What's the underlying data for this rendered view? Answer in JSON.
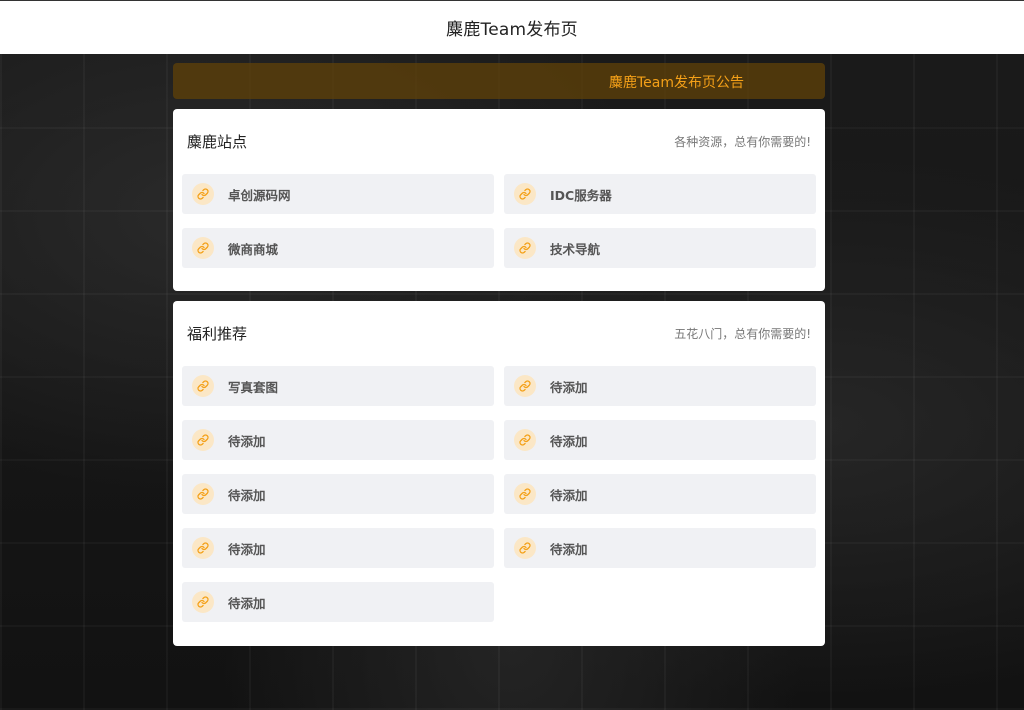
{
  "header": {
    "title": "麋鹿Team发布页"
  },
  "notice": {
    "text": "麋鹿Team发布页公告"
  },
  "sections": [
    {
      "title": "麋鹿站点",
      "subtitle": "各种资源，总有你需要的!",
      "links": [
        {
          "label": "卓创源码网",
          "icon": "link-icon"
        },
        {
          "label": "IDC服务器",
          "icon": "link-icon"
        },
        {
          "label": "微商商城",
          "icon": "link-icon"
        },
        {
          "label": "技术导航",
          "icon": "link-icon"
        }
      ]
    },
    {
      "title": "福利推荐",
      "subtitle": "五花八门，总有你需要的!",
      "links": [
        {
          "label": "写真套图",
          "icon": "link-icon"
        },
        {
          "label": "待添加",
          "icon": "link-icon"
        },
        {
          "label": "待添加",
          "icon": "link-icon"
        },
        {
          "label": "待添加",
          "icon": "link-icon"
        },
        {
          "label": "待添加",
          "icon": "link-icon"
        },
        {
          "label": "待添加",
          "icon": "link-icon"
        },
        {
          "label": "待添加",
          "icon": "link-icon"
        },
        {
          "label": "待添加",
          "icon": "link-icon"
        },
        {
          "label": "待添加",
          "icon": "link-icon"
        }
      ]
    }
  ],
  "colors": {
    "accent": "#f4a018",
    "icon_bg": "#fbe7c6",
    "item_bg": "#f0f1f4",
    "notice_bg": "#604208"
  }
}
